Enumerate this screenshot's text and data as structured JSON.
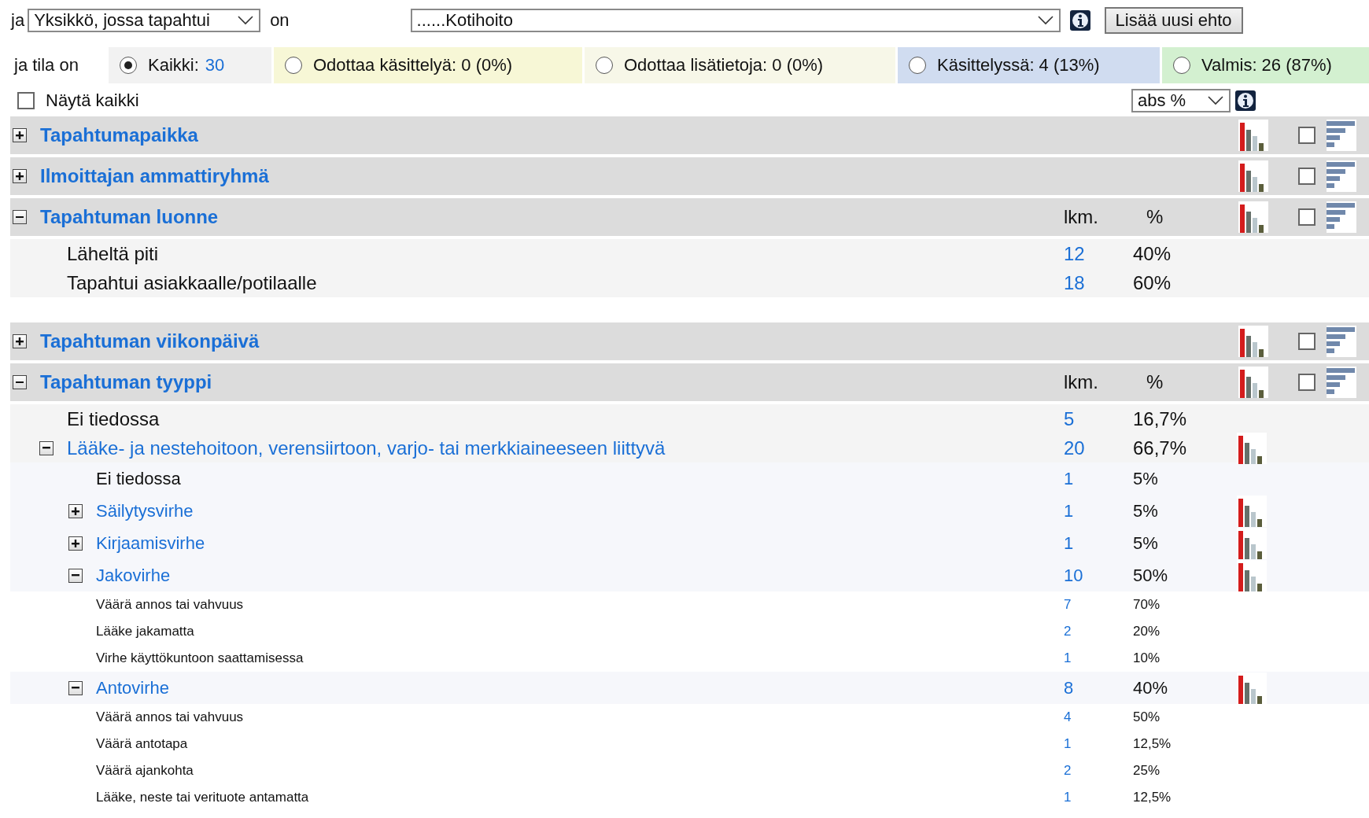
{
  "filter": {
    "prefix": "ja",
    "field": "Yksikkö, jossa tapahtui",
    "connector": "on",
    "value": "......Kotihoito",
    "add_button": "Lisää uusi ehto"
  },
  "status": {
    "label": "ja tila on",
    "options": [
      {
        "label": "Kaikki:",
        "count": "30",
        "selected": true,
        "color": "#f2f2f2"
      },
      {
        "label": "Odottaa käsittelyä: 0 (0%)",
        "selected": false,
        "color": "#f7f7d6"
      },
      {
        "label": "Odottaa lisätietoja: 0 (0%)",
        "selected": false,
        "color": "#f7f7e8"
      },
      {
        "label": "Käsittelyssä: 4 (13%)",
        "selected": false,
        "color": "#d0dcf0"
      },
      {
        "label": "Valmis: 26 (87%)",
        "selected": false,
        "color": "#d3f0d0"
      }
    ]
  },
  "show_all": {
    "label": "Näytä kaikki",
    "checked": false
  },
  "display_mode": {
    "value": "abs %"
  },
  "sections": [
    {
      "title": "Tapahtumapaikka",
      "expanded": false,
      "compare_checked": false
    },
    {
      "title": "Ilmoittajan ammattiryhmä",
      "expanded": false,
      "compare_checked": false
    },
    {
      "title": "Tapahtuman luonne",
      "expanded": true,
      "compare_checked": false,
      "columns": [
        "lkm.",
        "%"
      ],
      "rows": [
        {
          "label": "Läheltä piti",
          "count": "12",
          "percent": "40%",
          "has_chart": false
        },
        {
          "label": "Tapahtui asiakkaalle/potilaalle",
          "count": "18",
          "percent": "60%",
          "has_chart": false
        }
      ]
    },
    {
      "title": "Tapahtuman viikonpäivä",
      "expanded": false,
      "compare_checked": false
    },
    {
      "title": "Tapahtuman tyyppi",
      "expanded": true,
      "compare_checked": false,
      "columns": [
        "lkm.",
        "%"
      ],
      "rows": [
        {
          "label": "Ei tiedossa",
          "count": "5",
          "percent": "16,7%",
          "has_chart": false
        },
        {
          "label": "Lääke- ja nestehoitoon, verensiirtoon, varjo- tai merkkiaineeseen liittyvä",
          "count": "20",
          "percent": "66,7%",
          "has_chart": true,
          "expanded": true,
          "children": [
            {
              "label": "Ei tiedossa",
              "count": "1",
              "percent": "5%",
              "has_chart": false
            },
            {
              "label": "Säilytysvirhe",
              "count": "1",
              "percent": "5%",
              "has_chart": true,
              "expanded": false
            },
            {
              "label": "Kirjaamisvirhe",
              "count": "1",
              "percent": "5%",
              "has_chart": true,
              "expanded": false
            },
            {
              "label": "Jakovirhe",
              "count": "10",
              "percent": "50%",
              "has_chart": true,
              "expanded": true,
              "children": [
                {
                  "label": "Väärä annos tai vahvuus",
                  "count": "7",
                  "percent": "70%",
                  "has_chart": false
                },
                {
                  "label": "Lääke jakamatta",
                  "count": "2",
                  "percent": "20%",
                  "has_chart": false
                },
                {
                  "label": "Virhe käyttökuntoon saattamisessa",
                  "count": "1",
                  "percent": "10%",
                  "has_chart": false
                }
              ]
            },
            {
              "label": "Antovirhe",
              "count": "8",
              "percent": "40%",
              "has_chart": true,
              "expanded": true,
              "children": [
                {
                  "label": "Väärä annos tai vahvuus",
                  "count": "4",
                  "percent": "50%",
                  "has_chart": false
                },
                {
                  "label": "Väärä antotapa",
                  "count": "1",
                  "percent": "12,5%",
                  "has_chart": false
                },
                {
                  "label": "Väärä ajankohta",
                  "count": "2",
                  "percent": "25%",
                  "has_chart": false
                },
                {
                  "label": "Lääke, neste tai verituote antamatta",
                  "count": "1",
                  "percent": "12,5%",
                  "has_chart": false
                }
              ]
            }
          ]
        }
      ]
    }
  ]
}
